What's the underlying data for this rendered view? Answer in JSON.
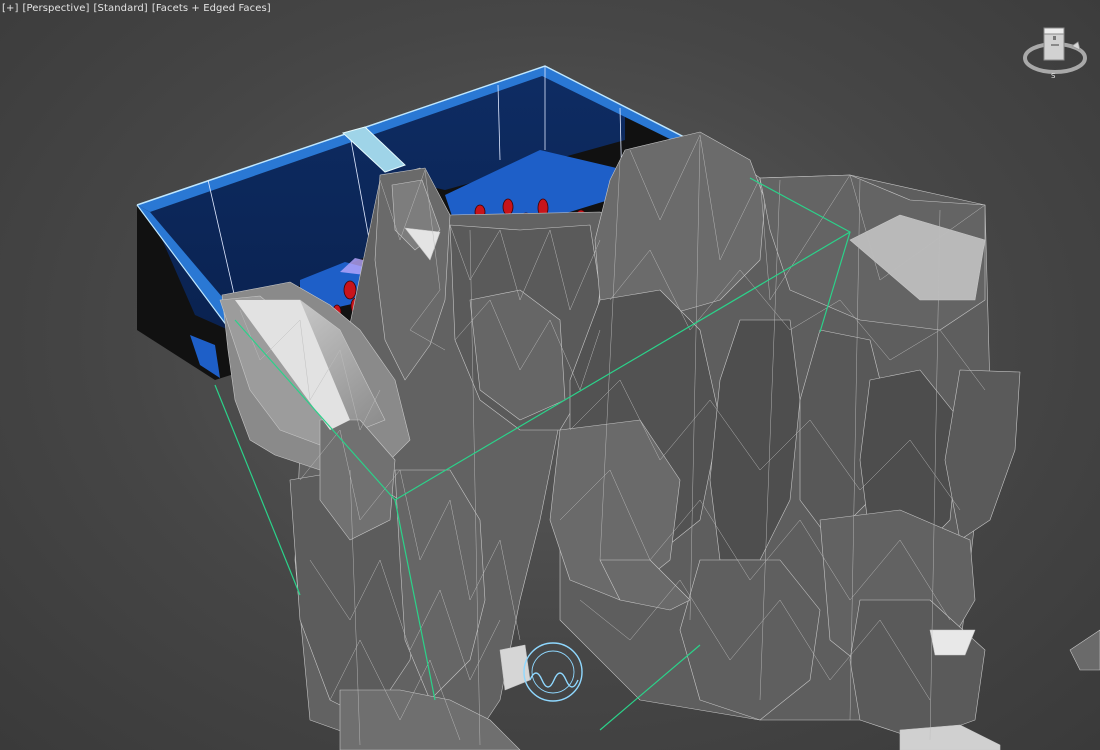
{
  "viewport": {
    "labels": {
      "plus": "[+]",
      "view": "[Perspective]",
      "shading": "[Standard]",
      "display": "[Facets + Edged Faces]"
    }
  },
  "viewcube": {
    "compass": "S"
  },
  "colors": {
    "background": "#4a4a4a",
    "rock": "#6f6f6f",
    "rock_edges": "#c8c8c8",
    "box_inner": "#0c2a5e",
    "box_floor": "#1e5fc8",
    "box_rim": "#2a78d4",
    "selection_edges": "#bfe7ff",
    "bounding_box": "#2bd28a",
    "gizmo": "#8fd8ff",
    "markers": "#c8141b"
  },
  "icons": [
    "viewcube-icon",
    "pivot-gizmo-icon"
  ]
}
